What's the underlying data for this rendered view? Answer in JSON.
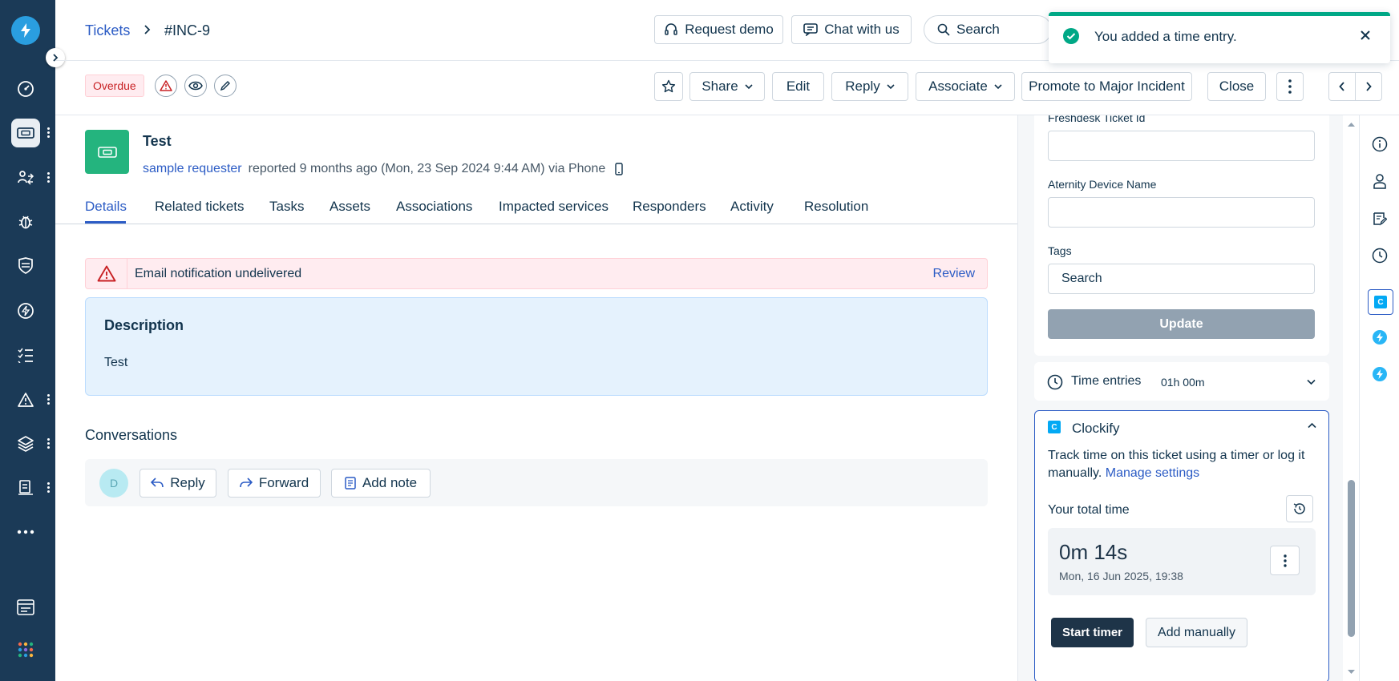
{
  "breadcrumb": {
    "parent": "Tickets",
    "current": "#INC-9"
  },
  "header": {
    "request_demo": "Request demo",
    "chat_with_us": "Chat with us",
    "search_label": "Search"
  },
  "toast": {
    "message": "You added a time entry."
  },
  "toolbar": {
    "status_badge": "Overdue",
    "share": "Share",
    "edit": "Edit",
    "reply": "Reply",
    "associate": "Associate",
    "promote": "Promote to Major Incident",
    "close": "Close"
  },
  "ticket": {
    "title": "Test",
    "requester": "sample requester",
    "meta": "reported 9 months ago (Mon, 23 Sep 2024 9:44 AM) via Phone"
  },
  "tabs": [
    "Details",
    "Related tickets",
    "Tasks",
    "Assets",
    "Associations",
    "Impacted services",
    "Responders",
    "Activity",
    "Resolution"
  ],
  "alert": {
    "text": "Email notification undelivered",
    "action": "Review"
  },
  "description": {
    "heading": "Description",
    "body": "Test"
  },
  "conversations": {
    "heading": "Conversations",
    "avatar_initial": "D",
    "reply": "Reply",
    "forward": "Forward",
    "add_note": "Add note"
  },
  "properties": {
    "freshdesk_label": "Freshdesk Ticket Id",
    "aternity_label": "Aternity Device Name",
    "tags_label": "Tags",
    "tags_placeholder": "Search",
    "update": "Update"
  },
  "time_entries": {
    "label": "Time entries",
    "value": "01h 00m"
  },
  "clockify": {
    "title": "Clockify",
    "logo_letter": "C",
    "description": "Track time on this ticket using a timer or log it manually.",
    "manage_link": "Manage settings",
    "total_label": "Your total time",
    "total_value": "0m 14s",
    "timestamp": "Mon, 16 Jun 2025, 19:38",
    "start_timer": "Start timer",
    "add_manually": "Add manually"
  },
  "colors": {
    "nav_bg": "#1b3a57",
    "accent": "#2c5cc5",
    "success": "#00a886",
    "danger": "#c82124",
    "ticket_icon": "#24b47e"
  }
}
